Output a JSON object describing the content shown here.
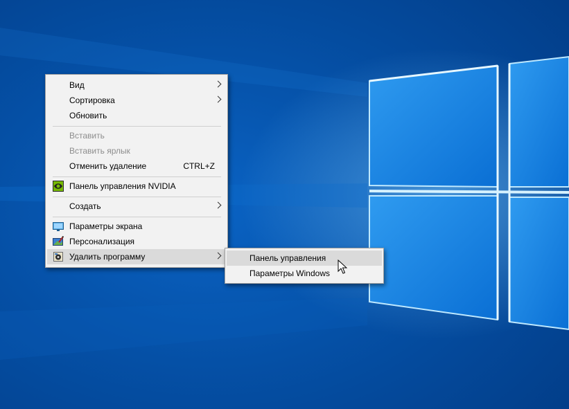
{
  "desktop": {
    "accent": "#0550a6",
    "light_accent": "#7fd0ff"
  },
  "context_menu": {
    "items": [
      {
        "label": "Вид",
        "submenu": true
      },
      {
        "label": "Сортировка",
        "submenu": true
      },
      {
        "label": "Обновить"
      },
      {
        "label": "Вставить",
        "disabled": true
      },
      {
        "label": "Вставить ярлык",
        "disabled": true
      },
      {
        "label": "Отменить удаление",
        "shortcut": "CTRL+Z"
      },
      {
        "label": "Панель управления NVIDIA",
        "icon": "nvidia-icon"
      },
      {
        "label": "Создать",
        "submenu": true
      },
      {
        "label": "Параметры экрана",
        "icon": "display-settings-icon"
      },
      {
        "label": "Персонализация",
        "icon": "personalization-icon"
      },
      {
        "label": "Удалить программу",
        "icon": "uninstall-program-icon",
        "submenu": true,
        "highlighted": true
      }
    ]
  },
  "submenu": {
    "items": [
      {
        "label": "Панель управления",
        "highlighted": true
      },
      {
        "label": "Параметры Windows"
      }
    ]
  },
  "cursor": {
    "icon": "mouse-pointer-icon"
  }
}
